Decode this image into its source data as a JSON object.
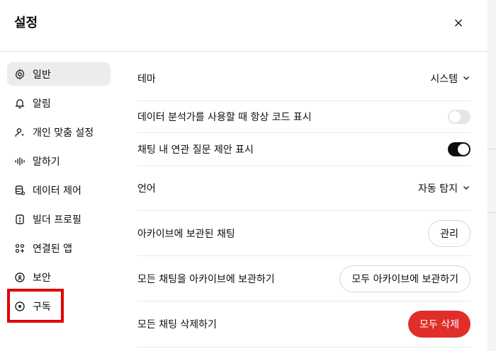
{
  "modal": {
    "title": "설정",
    "close_label": "×"
  },
  "sidebar": {
    "items": [
      {
        "label": "일반",
        "icon": "gear-icon",
        "active": true
      },
      {
        "label": "알림",
        "icon": "bell-icon"
      },
      {
        "label": "개인 맞춤 설정",
        "icon": "person-sparkle-icon"
      },
      {
        "label": "말하기",
        "icon": "waveform-icon"
      },
      {
        "label": "데이터 제어",
        "icon": "database-icon"
      },
      {
        "label": "빌더 프로필",
        "icon": "id-card-icon"
      },
      {
        "label": "연결된 앱",
        "icon": "apps-icon"
      },
      {
        "label": "보안",
        "icon": "shield-lock-icon"
      },
      {
        "label": "구독",
        "icon": "subscription-icon"
      }
    ],
    "highlight_color": "#e00000"
  },
  "settings": {
    "theme": {
      "label": "테마",
      "value": "시스템"
    },
    "code_display": {
      "label": "데이터 분석가를 사용할 때 항상 코드 표시",
      "enabled": false
    },
    "follow_up": {
      "label": "채팅 내 연관 질문 제안 표시",
      "enabled": true
    },
    "language": {
      "label": "언어",
      "value": "자동 탐지"
    },
    "archived": {
      "label": "아카이브에 보관된 채팅",
      "button": "관리"
    },
    "archive_all": {
      "label": "모든 채팅을 아카이브에 보관하기",
      "button": "모두 아카이브에 보관하기"
    },
    "delete_all": {
      "label": "모든 채팅 삭제하기",
      "button": "모두 삭제",
      "button_color": "#e02e2a"
    }
  }
}
